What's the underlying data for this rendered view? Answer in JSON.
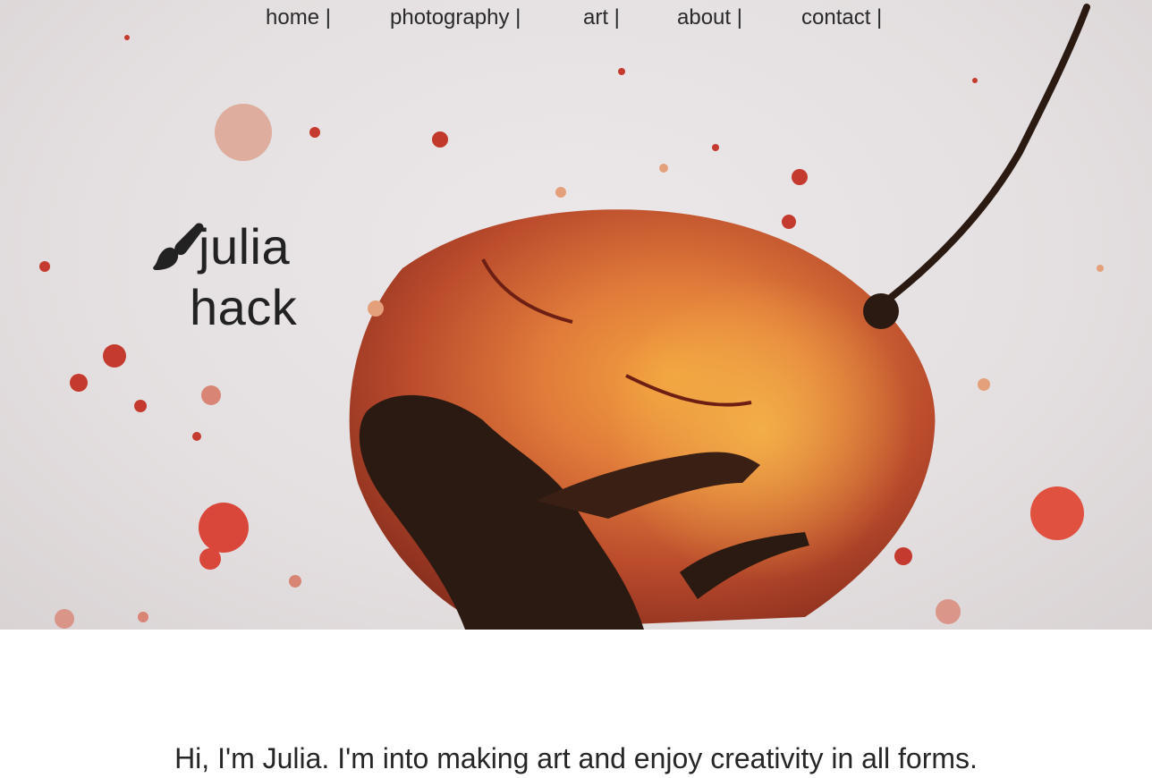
{
  "nav": {
    "items": [
      {
        "label": "home |"
      },
      {
        "label": "photography |"
      },
      {
        "label": "art |"
      },
      {
        "label": "about |"
      },
      {
        "label": "contact |"
      }
    ]
  },
  "logo": {
    "icon": "paintbrush-icon",
    "line1": "julia",
    "line2": "hack"
  },
  "intro": {
    "text": "Hi, I'm Julia. I'm into making art and enjoy creativity in all forms."
  },
  "colors": {
    "paper": "#e6e1e2",
    "ink_red": "#c0392b",
    "ink_orange": "#e4862f",
    "ink_dark": "#2a1a12",
    "text": "#222222"
  }
}
